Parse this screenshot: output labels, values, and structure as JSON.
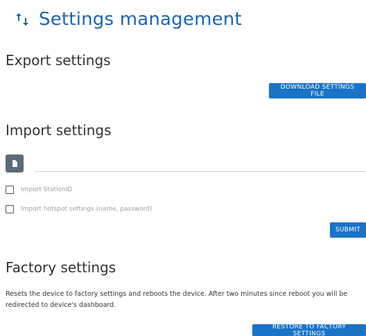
{
  "header": {
    "title": "Settings management",
    "icon": "sort-arrows-icon",
    "accent": "#1b66b1"
  },
  "export": {
    "title": "Export settings",
    "download_label": "DOWNLOAD SETTINGS FILE"
  },
  "import": {
    "title": "Import settings",
    "file_value": "",
    "file_button_icon": "file-icon",
    "options": [
      {
        "label": "Import StationID",
        "checked": false
      },
      {
        "label": "Import hotspot settings (name, password)",
        "checked": false
      }
    ],
    "submit_label": "SUBMIT"
  },
  "factory": {
    "title": "Factory settings",
    "description": "Resets the device to factory settings and reboots the device. After two minutes since reboot you will be redirected to device's dashboard.",
    "restore_label": "RESTORE TO FACTORY SETTINGS"
  },
  "colors": {
    "button": "#1a73c6",
    "file_button": "#5b6b7b"
  }
}
